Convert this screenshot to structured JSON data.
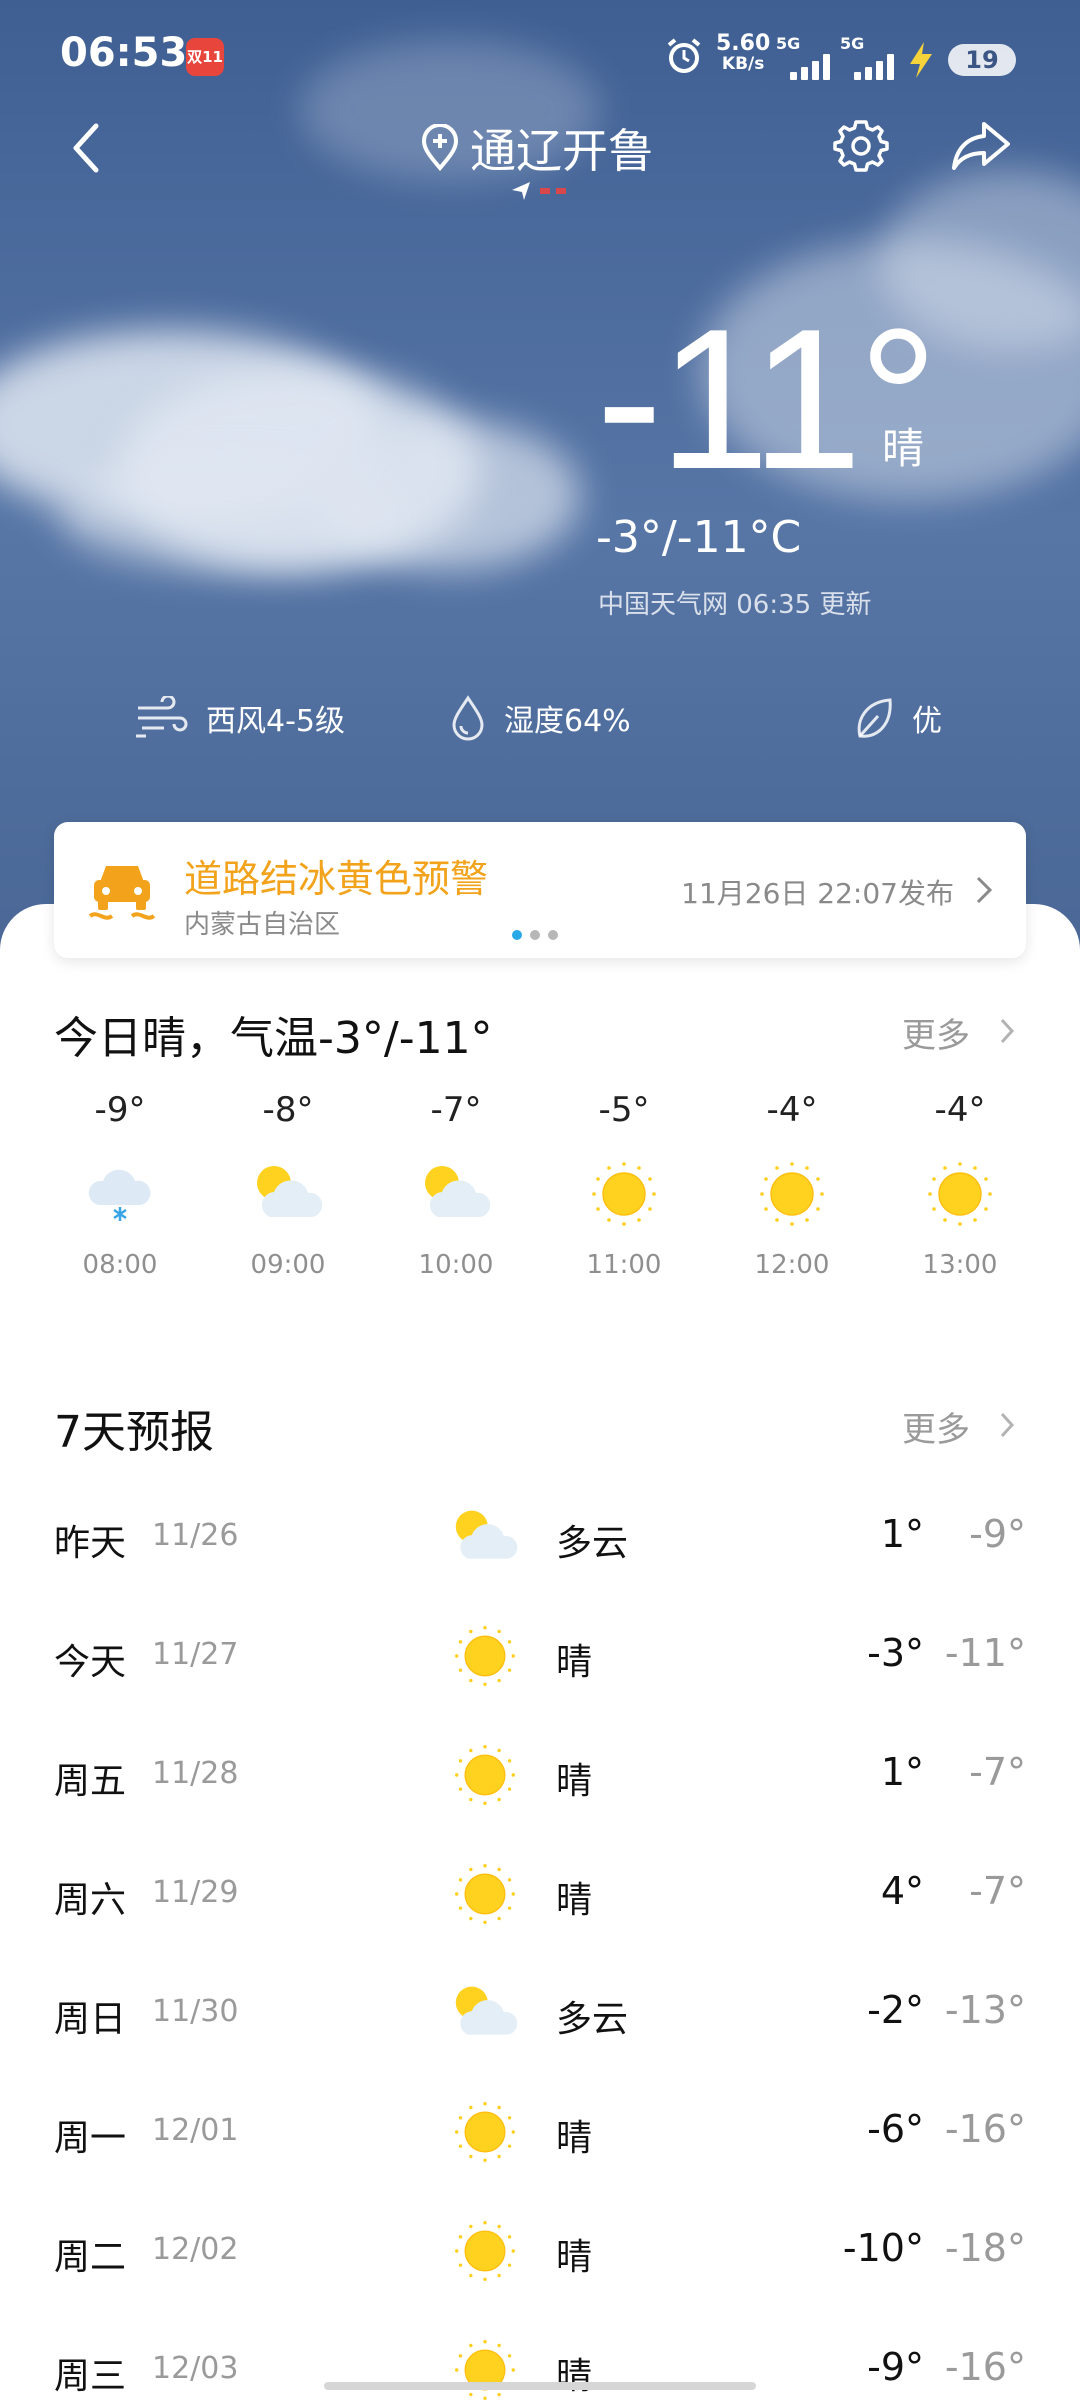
{
  "status_bar": {
    "time": "06:53",
    "notif_badge": "双11",
    "speed_value": "5.60",
    "speed_unit": "KB/s",
    "net1": "5G",
    "net2": "5G",
    "battery": "19"
  },
  "header": {
    "city": "通辽开鲁"
  },
  "current": {
    "temp": "-11°",
    "condition": "晴",
    "range": "-3°/-11°C",
    "source": "中国天气网 06:35 更新",
    "wind": "西风4-5级",
    "humidity": "湿度64%",
    "air": "优"
  },
  "alert": {
    "title": "道路结冰黄色预警",
    "region": "内蒙古自治区",
    "time": "11月26日 22:07发布"
  },
  "today": {
    "title": "今日晴，气温-3°/-11°",
    "more": "更多",
    "hours": [
      {
        "temp": "-9°",
        "time": "08:00",
        "icon": "snow-icon"
      },
      {
        "temp": "-8°",
        "time": "09:00",
        "icon": "partly-cloudy-icon"
      },
      {
        "temp": "-7°",
        "time": "10:00",
        "icon": "partly-cloudy-icon"
      },
      {
        "temp": "-5°",
        "time": "11:00",
        "icon": "sun-icon"
      },
      {
        "temp": "-4°",
        "time": "12:00",
        "icon": "sun-icon"
      },
      {
        "temp": "-4°",
        "time": "13:00",
        "icon": "sun-icon"
      }
    ]
  },
  "forecast": {
    "title": "7天预报",
    "more": "更多",
    "days": [
      {
        "day": "昨天",
        "date": "11/26",
        "cond": "多云",
        "hi": "1°",
        "lo": "-9°",
        "icon": "partly-cloudy-icon"
      },
      {
        "day": "今天",
        "date": "11/27",
        "cond": "晴",
        "hi": "-3°",
        "lo": "-11°",
        "icon": "sun-icon"
      },
      {
        "day": "周五",
        "date": "11/28",
        "cond": "晴",
        "hi": "1°",
        "lo": "-7°",
        "icon": "sun-icon"
      },
      {
        "day": "周六",
        "date": "11/29",
        "cond": "晴",
        "hi": "4°",
        "lo": "-7°",
        "icon": "sun-icon"
      },
      {
        "day": "周日",
        "date": "11/30",
        "cond": "多云",
        "hi": "-2°",
        "lo": "-13°",
        "icon": "partly-cloudy-icon"
      },
      {
        "day": "周一",
        "date": "12/01",
        "cond": "晴",
        "hi": "-6°",
        "lo": "-16°",
        "icon": "sun-icon"
      },
      {
        "day": "周二",
        "date": "12/02",
        "cond": "晴",
        "hi": "-10°",
        "lo": "-18°",
        "icon": "sun-icon"
      },
      {
        "day": "周三",
        "date": "12/03",
        "cond": "晴",
        "hi": "-9°",
        "lo": "-16°",
        "icon": "sun-icon"
      }
    ]
  },
  "colors": {
    "sky": "#4d6c9e",
    "alert": "#f2a31b",
    "sun": "#ffd21f",
    "dot_active": "#2aa9e8"
  }
}
